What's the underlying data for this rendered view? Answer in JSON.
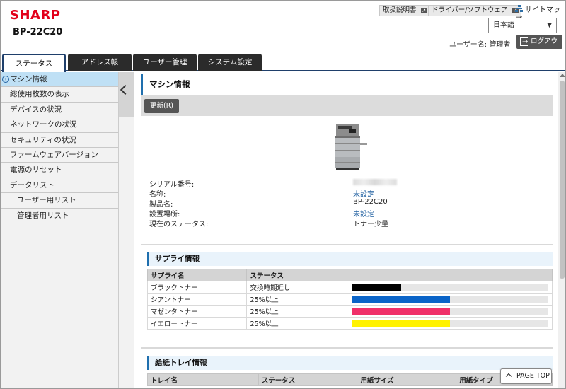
{
  "header": {
    "logo": "SHARP",
    "model": "BP-22C20",
    "links": [
      {
        "label": "取扱説明書"
      },
      {
        "label": "ドライバー/ソフトウェア"
      }
    ],
    "sitemap": "サイトマップ",
    "language": "日本語",
    "user_label": "ユーザー名: 管理者",
    "logout": "ログアウト"
  },
  "tabs": [
    {
      "label": "ステータス",
      "active": true
    },
    {
      "label": "アドレス帳"
    },
    {
      "label": "ユーザー管理"
    },
    {
      "label": "システム設定"
    }
  ],
  "sidebar": {
    "items": [
      {
        "label": "マシン情報",
        "active": true
      },
      {
        "label": "総使用枚数の表示"
      },
      {
        "label": "デバイスの状況"
      },
      {
        "label": "ネットワークの状況"
      },
      {
        "label": "セキュリティの状況"
      },
      {
        "label": "ファームウェアバージョン"
      },
      {
        "label": "電源のリセット"
      },
      {
        "label": "データリスト"
      },
      {
        "label": "ユーザー用リスト",
        "sub": true
      },
      {
        "label": "管理者用リスト",
        "sub": true
      }
    ]
  },
  "main": {
    "title": "マシン情報",
    "refresh": "更新(R)",
    "info": [
      {
        "label": "シリアル番号:",
        "value": ""
      },
      {
        "label": "名称:",
        "value": "未設定"
      },
      {
        "label": "製品名:",
        "value": "BP-22C20"
      },
      {
        "label": "設置場所:",
        "value": "未設定"
      },
      {
        "label": "現在のステータス:",
        "value": "トナー少量"
      }
    ],
    "supply": {
      "title": "サプライ情報",
      "headers": [
        "サプライ名",
        "ステータス"
      ],
      "rows": [
        {
          "name": "ブラックトナー",
          "status": "交換時期近し",
          "level": 0.25,
          "color": "#000000"
        },
        {
          "name": "シアントナー",
          "status": "25%以上",
          "level": 0.5,
          "color": "#0a64c8"
        },
        {
          "name": "マゼンタトナー",
          "status": "25%以上",
          "level": 0.5,
          "color": "#f0306a"
        },
        {
          "name": "イエロートナー",
          "status": "25%以上",
          "level": 0.5,
          "color": "#fff200"
        }
      ]
    },
    "tray": {
      "title": "給紙トレイ情報",
      "headers": [
        "トレイ名",
        "ステータス",
        "用紙サイズ",
        "用紙タイプ"
      ]
    },
    "page_top": "PAGE TOP"
  },
  "colors": {
    "brand": "#e2001a",
    "accent": "#1f6fae",
    "tab_dark": "#2b2b2b",
    "nav_active": "#bfe0f5"
  }
}
